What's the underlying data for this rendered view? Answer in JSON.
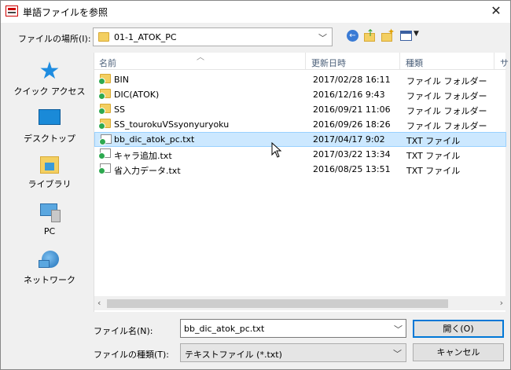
{
  "window": {
    "title": "単語ファイルを参照",
    "close_glyph": "✕"
  },
  "location": {
    "label": "ファイルの場所(I):",
    "value": "01-1_ATOK_PC"
  },
  "nav": {
    "items": [
      {
        "label": "クイック アクセス",
        "icon": "quick-access-star-icon"
      },
      {
        "label": "デスクトップ",
        "icon": "desktop-icon"
      },
      {
        "label": "ライブラリ",
        "icon": "library-icon"
      },
      {
        "label": "PC",
        "icon": "pc-icon"
      },
      {
        "label": "ネットワーク",
        "icon": "network-icon"
      }
    ]
  },
  "columns": {
    "name": "名前",
    "date": "更新日時",
    "type": "種類",
    "size": "サ"
  },
  "files": [
    {
      "name": "BIN",
      "date": "2017/02/28 16:11",
      "type": "ファイル フォルダー",
      "icon": "folder-icon",
      "selected": false
    },
    {
      "name": "DIC(ATOK)",
      "date": "2016/12/16 9:43",
      "type": "ファイル フォルダー",
      "icon": "folder-icon",
      "selected": false
    },
    {
      "name": "SS",
      "date": "2016/09/21 11:06",
      "type": "ファイル フォルダー",
      "icon": "folder-icon",
      "selected": false
    },
    {
      "name": "SS_tourokuVSsyonyuryoku",
      "date": "2016/09/26 18:26",
      "type": "ファイル フォルダー",
      "icon": "folder-icon",
      "selected": false
    },
    {
      "name": "bb_dic_atok_pc.txt",
      "date": "2017/04/17 9:02",
      "type": "TXT ファイル",
      "icon": "text-file-icon",
      "selected": true
    },
    {
      "name": "キャラ追加.txt",
      "date": "2017/03/22 13:34",
      "type": "TXT ファイル",
      "icon": "text-file-icon",
      "selected": false
    },
    {
      "name": "省入力データ.txt",
      "date": "2016/08/25 13:51",
      "type": "TXT ファイル",
      "icon": "text-file-icon",
      "selected": false
    }
  ],
  "filename": {
    "label": "ファイル名(N):",
    "value": "bb_dic_atok_pc.txt"
  },
  "filetype": {
    "label": "ファイルの種類(T):",
    "value": "テキストファイル (*.txt)"
  },
  "buttons": {
    "open": "開く(O)",
    "cancel": "キャンセル"
  },
  "colors": {
    "selection": "#cce8ff",
    "accent": "#0078d7",
    "folder": "#f3cf61"
  }
}
